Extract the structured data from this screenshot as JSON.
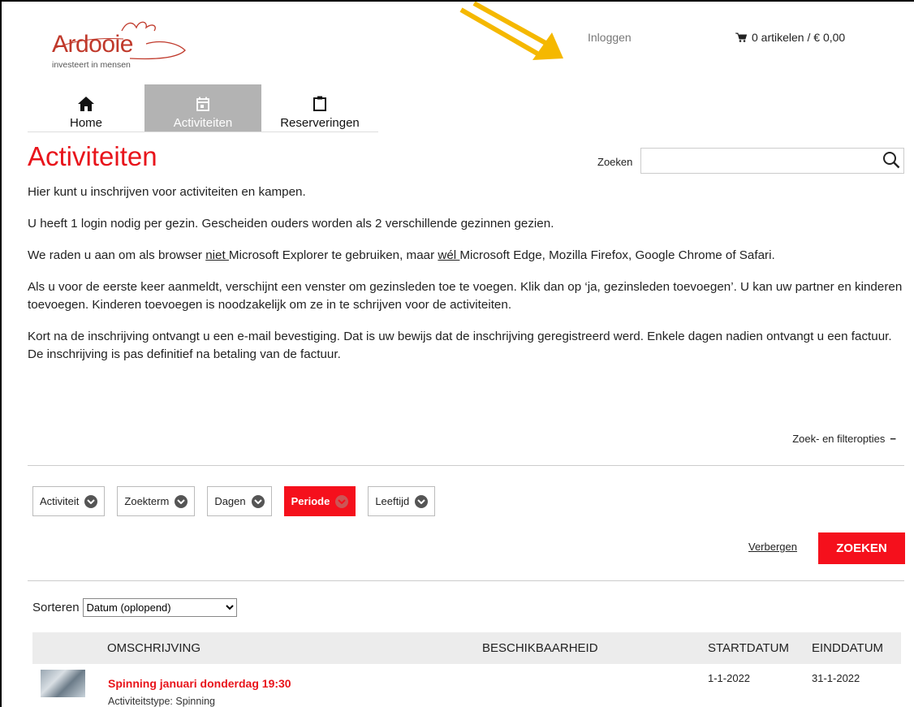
{
  "header": {
    "logo_name": "Ardooie",
    "logo_tagline": "investeert in mensen",
    "login": "Inloggen",
    "cart": "0 artikelen / € 0,00"
  },
  "nav": {
    "tabs": [
      {
        "label": "Home",
        "icon": "home-icon"
      },
      {
        "label": "Activiteiten",
        "icon": "calendar-icon",
        "active": true
      },
      {
        "label": "Reserveringen",
        "icon": "clipboard-icon"
      }
    ]
  },
  "page": {
    "title": "Activiteiten",
    "search_label": "Zoeken",
    "search_value": "",
    "intro": [
      "Hier kunt u inschrijven voor activiteiten en kampen.",
      "U heeft 1 login nodig per gezin. Gescheiden ouders worden als 2 verschillende gezinnen gezien.",
      {
        "a": "We raden u aan om als browser ",
        "u1": "niet ",
        "b": "Microsoft Explorer te gebruiken, maar ",
        "u2": "wél ",
        "c": "Microsoft Edge, Mozilla Firefox, Google Chrome of Safari."
      },
      "Als u voor de eerste keer aanmeldt, verschijnt een venster om gezinsleden toe te voegen. Klik dan op ‘ja, gezinsleden toevoegen’. U kan uw partner en kinderen toevoegen. Kinderen toevoegen is noodzakelijk om ze in te schrijven voor de activiteiten.",
      "Kort na de inschrijving ontvangt u een e-mail bevestiging. Dat is uw bewijs dat de inschrijving geregistreerd werd. Enkele dagen nadien ontvangt u een factuur. De inschrijving is pas definitief na betaling van de factuur."
    ]
  },
  "filters": {
    "toggle_label": "Zoek- en filteropties",
    "toggle_symbol": "−",
    "buttons": [
      {
        "label": "Activiteit",
        "active": false
      },
      {
        "label": "Zoekterm",
        "active": false
      },
      {
        "label": "Dagen",
        "active": false
      },
      {
        "label": "Periode",
        "active": true
      },
      {
        "label": "Leeftijd",
        "active": false
      }
    ],
    "hide_label": "Verbergen",
    "search_button": "ZOEKEN"
  },
  "sort": {
    "label": "Sorteren",
    "selected": "Datum (oplopend)"
  },
  "table": {
    "headers": [
      "OMSCHRIJVING",
      "BESCHIKBAARHEID",
      "STARTDATUM",
      "EINDDATUM"
    ],
    "rows": [
      {
        "title": "Spinning januari donderdag 19:30",
        "type": "Activiteitstype: Spinning",
        "start": "1-1-2022",
        "end": "31-1-2022"
      }
    ]
  },
  "colors": {
    "accent": "#e8141b",
    "active_tab": "#b3b3b3",
    "arrow": "#f5b800"
  }
}
